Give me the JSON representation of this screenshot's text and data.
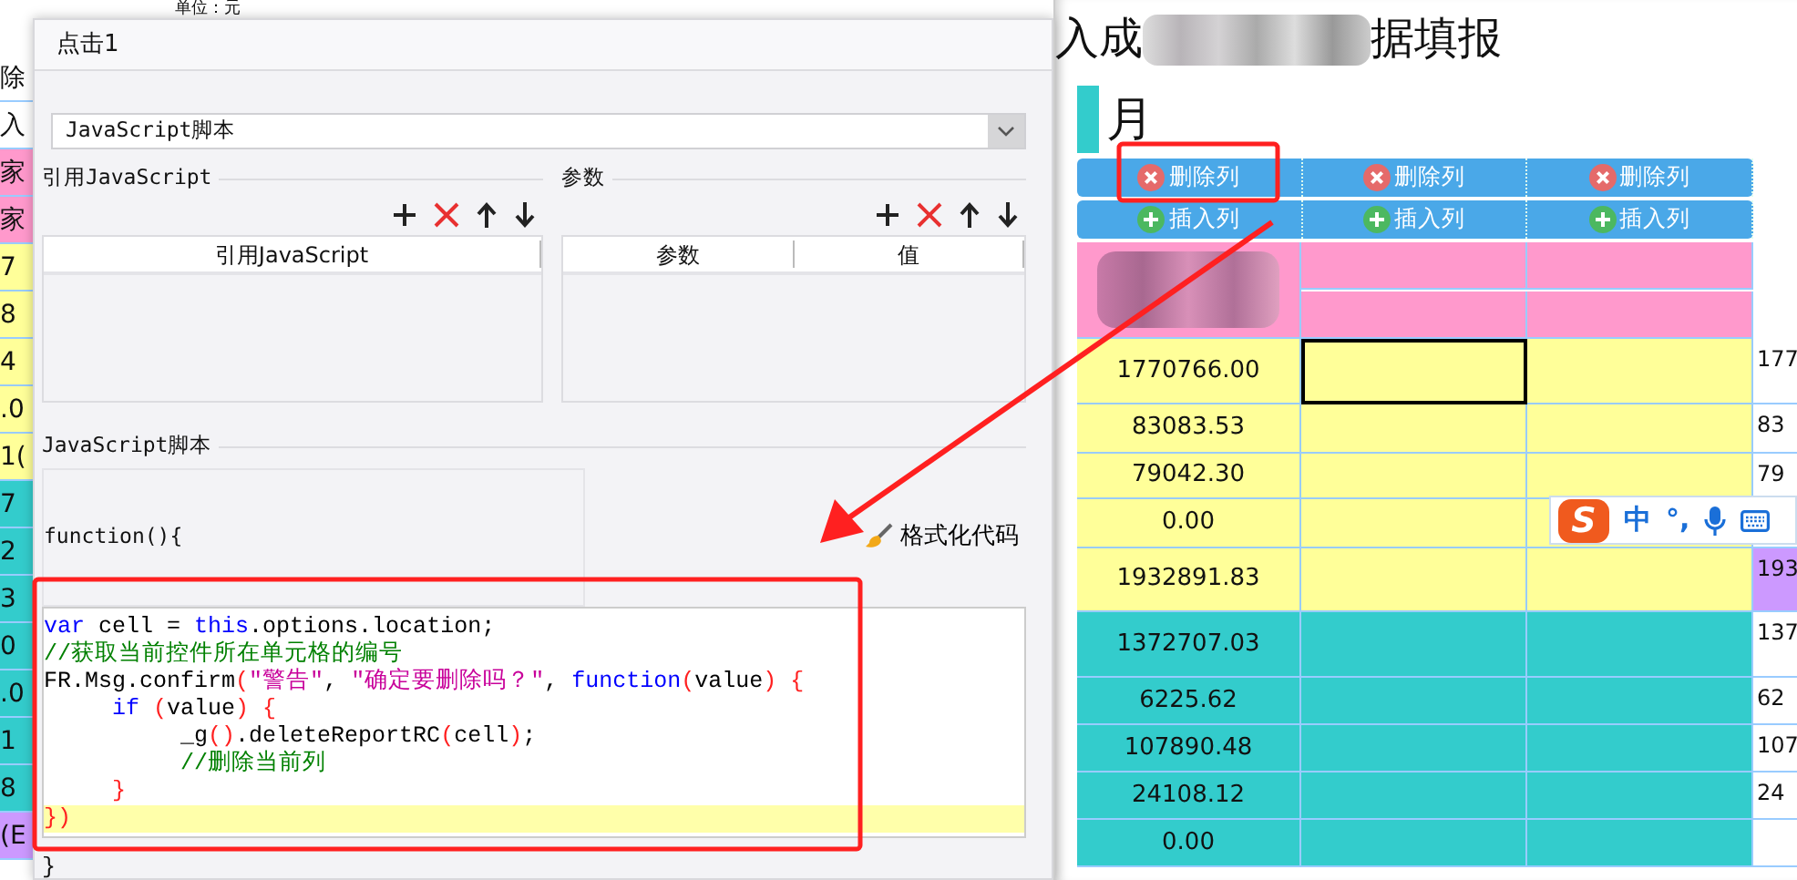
{
  "background": {
    "unit_label": "单位：元",
    "left_strip": [
      {
        "text": "除",
        "color": "#ffffff"
      },
      {
        "text": "入",
        "color": "#ffffff"
      },
      {
        "text": "家",
        "color": "#ff99cc"
      },
      {
        "text": "家",
        "color": "#ff99cc"
      },
      {
        "text": "7",
        "color": "#ffff99"
      },
      {
        "text": "8",
        "color": "#ffff99"
      },
      {
        "text": "4",
        "color": "#ffff99"
      },
      {
        "text": ".0",
        "color": "#ffff99"
      },
      {
        "text": "1(",
        "color": "#ffff99"
      },
      {
        "text": "7",
        "color": "#33cccc"
      },
      {
        "text": "2",
        "color": "#33cccc"
      },
      {
        "text": "3",
        "color": "#33cccc"
      },
      {
        "text": "0",
        "color": "#33cccc"
      },
      {
        "text": ".0",
        "color": "#33cccc"
      },
      {
        "text": "1",
        "color": "#33cccc"
      },
      {
        "text": "8",
        "color": "#33cccc"
      },
      {
        "text": "(E",
        "color": "#cc99ff"
      }
    ]
  },
  "dialog": {
    "title": "点击1",
    "script_type": {
      "value": "JavaScript脚本"
    },
    "referenced_js": {
      "label": "引用JavaScript",
      "columns": [
        "引用JavaScript"
      ]
    },
    "parameters": {
      "label": "参数",
      "columns": [
        "参数",
        "值"
      ]
    },
    "script_label": "JavaScript脚本",
    "function_header": "function(){",
    "format_button": "格式化代码",
    "code_lines": [
      {
        "highlighted": false,
        "tokens": [
          {
            "kind": "keyword",
            "text": "var"
          },
          {
            "kind": "plain",
            "text": " cell = "
          },
          {
            "kind": "keyword",
            "text": "this"
          },
          {
            "kind": "plain",
            "text": ".options.location;"
          }
        ]
      },
      {
        "highlighted": false,
        "tokens": [
          {
            "kind": "comment",
            "text": "//获取当前控件所在单元格的编号"
          }
        ]
      },
      {
        "highlighted": false,
        "tokens": [
          {
            "kind": "plain",
            "text": "FR.Msg.confirm"
          },
          {
            "kind": "bracket",
            "text": "("
          },
          {
            "kind": "string",
            "text": "\"警告\""
          },
          {
            "kind": "plain",
            "text": ", "
          },
          {
            "kind": "string",
            "text": "\"确定要删除吗？\""
          },
          {
            "kind": "plain",
            "text": ", "
          },
          {
            "kind": "keyword",
            "text": "function"
          },
          {
            "kind": "bracket",
            "text": "("
          },
          {
            "kind": "plain",
            "text": "value"
          },
          {
            "kind": "bracket",
            "text": ") {"
          }
        ]
      },
      {
        "highlighted": false,
        "tokens": [
          {
            "kind": "keyword",
            "text": "     if"
          },
          {
            "kind": "bracket",
            "text": " ("
          },
          {
            "kind": "plain",
            "text": "value"
          },
          {
            "kind": "bracket",
            "text": ") {"
          }
        ]
      },
      {
        "highlighted": false,
        "tokens": [
          {
            "kind": "plain",
            "text": "          _g"
          },
          {
            "kind": "bracket",
            "text": "()"
          },
          {
            "kind": "plain",
            "text": ".deleteReportRC"
          },
          {
            "kind": "bracket",
            "text": "("
          },
          {
            "kind": "plain",
            "text": "cell"
          },
          {
            "kind": "bracket",
            "text": ")"
          },
          {
            "kind": "plain",
            "text": ";"
          }
        ]
      },
      {
        "highlighted": false,
        "tokens": [
          {
            "kind": "comment",
            "text": "          //删除当前列"
          }
        ]
      },
      {
        "highlighted": false,
        "tokens": [
          {
            "kind": "bracket",
            "text": "     }"
          }
        ]
      },
      {
        "highlighted": true,
        "tokens": [
          {
            "kind": "bracket",
            "text": "})"
          }
        ]
      }
    ],
    "closing": "}"
  },
  "report": {
    "title_start": "入成",
    "title_end": "据填报",
    "month": "月",
    "delete_buttons": [
      "删除列",
      "删除列",
      "删除列"
    ],
    "insert_buttons": [
      "插入列",
      "插入列",
      "插入列"
    ],
    "rows": [
      {
        "color": "#ffff99",
        "cells": [
          {
            "text": "1770766.00",
            "selected": false
          },
          {
            "text": "",
            "selected": true
          },
          {
            "text": "",
            "selected": false
          }
        ],
        "overflow": {
          "text": "177",
          "color": "#ffffff"
        }
      },
      {
        "color": "#ffff99",
        "cells": [
          {
            "text": "83083.53",
            "selected": false
          },
          {
            "text": "",
            "selected": false
          },
          {
            "text": "",
            "selected": false
          }
        ],
        "overflow": {
          "text": "83",
          "color": "#ffffff"
        }
      },
      {
        "color": "#ffff99",
        "cells": [
          {
            "text": "79042.30",
            "selected": false
          },
          {
            "text": "",
            "selected": false
          },
          {
            "text": "",
            "selected": false
          }
        ],
        "overflow": {
          "text": "79",
          "color": "#ffffff"
        }
      },
      {
        "color": "#ffff99",
        "cells": [
          {
            "text": "0.00",
            "selected": false
          },
          {
            "text": "",
            "selected": false
          },
          {
            "text": "",
            "selected": false
          }
        ],
        "overflow": {
          "color": "#ffffff"
        }
      },
      {
        "color": "#ffff99",
        "cells": [
          {
            "text": "1932891.83",
            "selected": false
          },
          {
            "text": "",
            "selected": false
          },
          {
            "text": "",
            "selected": false
          }
        ],
        "overflow": {
          "text": "193",
          "color": "#cc99ff"
        }
      },
      {
        "color": "#33cccc",
        "cells": [
          {
            "text": "1372707.03",
            "selected": false
          },
          {
            "text": "",
            "selected": false
          },
          {
            "text": "",
            "selected": false
          }
        ],
        "overflow": {
          "text": "137",
          "color": "#ffffff"
        }
      },
      {
        "color": "#33cccc",
        "cells": [
          {
            "text": "6225.62",
            "selected": false
          },
          {
            "text": "",
            "selected": false
          },
          {
            "text": "",
            "selected": false
          }
        ],
        "overflow": {
          "text": "62",
          "color": "#ffffff"
        }
      },
      {
        "color": "#33cccc",
        "cells": [
          {
            "text": "107890.48",
            "selected": false
          },
          {
            "text": "",
            "selected": false
          },
          {
            "text": "",
            "selected": false
          }
        ],
        "overflow": {
          "text": "107",
          "color": "#ffffff"
        }
      },
      {
        "color": "#33cccc",
        "cells": [
          {
            "text": "24108.12",
            "selected": false
          },
          {
            "text": "",
            "selected": false
          },
          {
            "text": "",
            "selected": false
          }
        ],
        "overflow": {
          "text": "24",
          "color": "#ffffff"
        }
      },
      {
        "color": "#33cccc",
        "cells": [
          {
            "text": "0.00",
            "selected": false
          },
          {
            "text": "",
            "selected": false
          },
          {
            "text": "",
            "selected": false
          }
        ],
        "overflow": {
          "color": "#ffffff"
        }
      }
    ]
  },
  "ime_toolbar": {
    "logo": "S",
    "mode": "中",
    "punctuation": "°,"
  }
}
